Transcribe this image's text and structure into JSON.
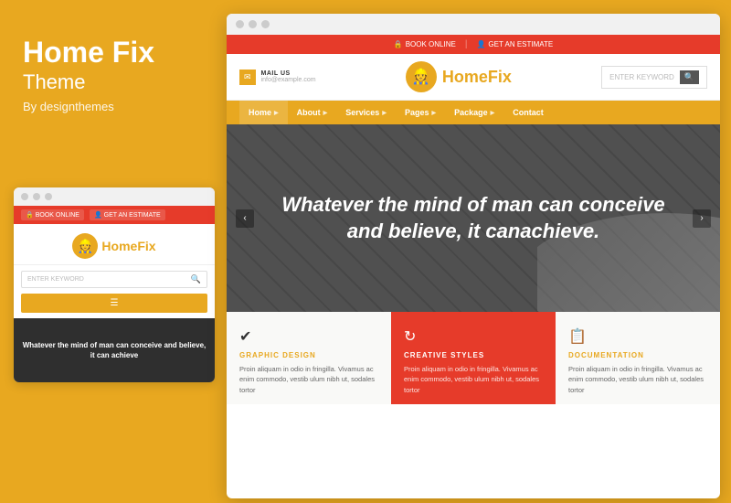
{
  "left": {
    "title": "Home Fix",
    "subtitle": "Theme",
    "by": "By designthemes"
  },
  "small_browser": {
    "dots": [
      "dot1",
      "dot2",
      "dot3"
    ],
    "topbar": {
      "btn1": "BOOK ONLINE",
      "btn2": "GET AN ESTIMATE"
    },
    "logo": {
      "text_before": "Home",
      "text_after": "Fix"
    },
    "search_placeholder": "ENTER KEYWORD",
    "hero_text": "Whatever the mind of man can conceive and believe, it can achieve"
  },
  "right_browser": {
    "dots": [
      "dot1",
      "dot2",
      "dot3"
    ],
    "topbar": {
      "btn1": "BOOK ONLINE",
      "divider": "|",
      "btn2": "GET AN ESTIMATE"
    },
    "header": {
      "mail_label": "MAIL US",
      "mail_address": "info@example.com",
      "logo_before": "Home",
      "logo_after": "Fix",
      "search_placeholder": "ENTER KEYWORD"
    },
    "nav": {
      "items": [
        "Home",
        "About",
        "Services",
        "Pages",
        "Package",
        "Contact"
      ]
    },
    "hero": {
      "text": "Whatever the mind of man can conceive and believe, it canachieve."
    },
    "cards": [
      {
        "icon": "✔",
        "title": "GRAPHIC DESIGN",
        "body": "Proin aliquam in odio in fringilla. Vivamus ac enim commodo, vestib ulum nibh ut, sodales tortor"
      },
      {
        "icon": "↻",
        "title": "CREATIVE STYLES",
        "body": "Proin aliquam in odio in fringilla. Vivamus ac enim commodo, vestib ulum nibh ut, sodales tortor"
      },
      {
        "icon": "📋",
        "title": "DOCUMENTATION",
        "body": "Proin aliquam in odio in fringilla. Vivamus ac enim commodo, vestib ulum nibh ut, sodales tortor"
      }
    ]
  }
}
